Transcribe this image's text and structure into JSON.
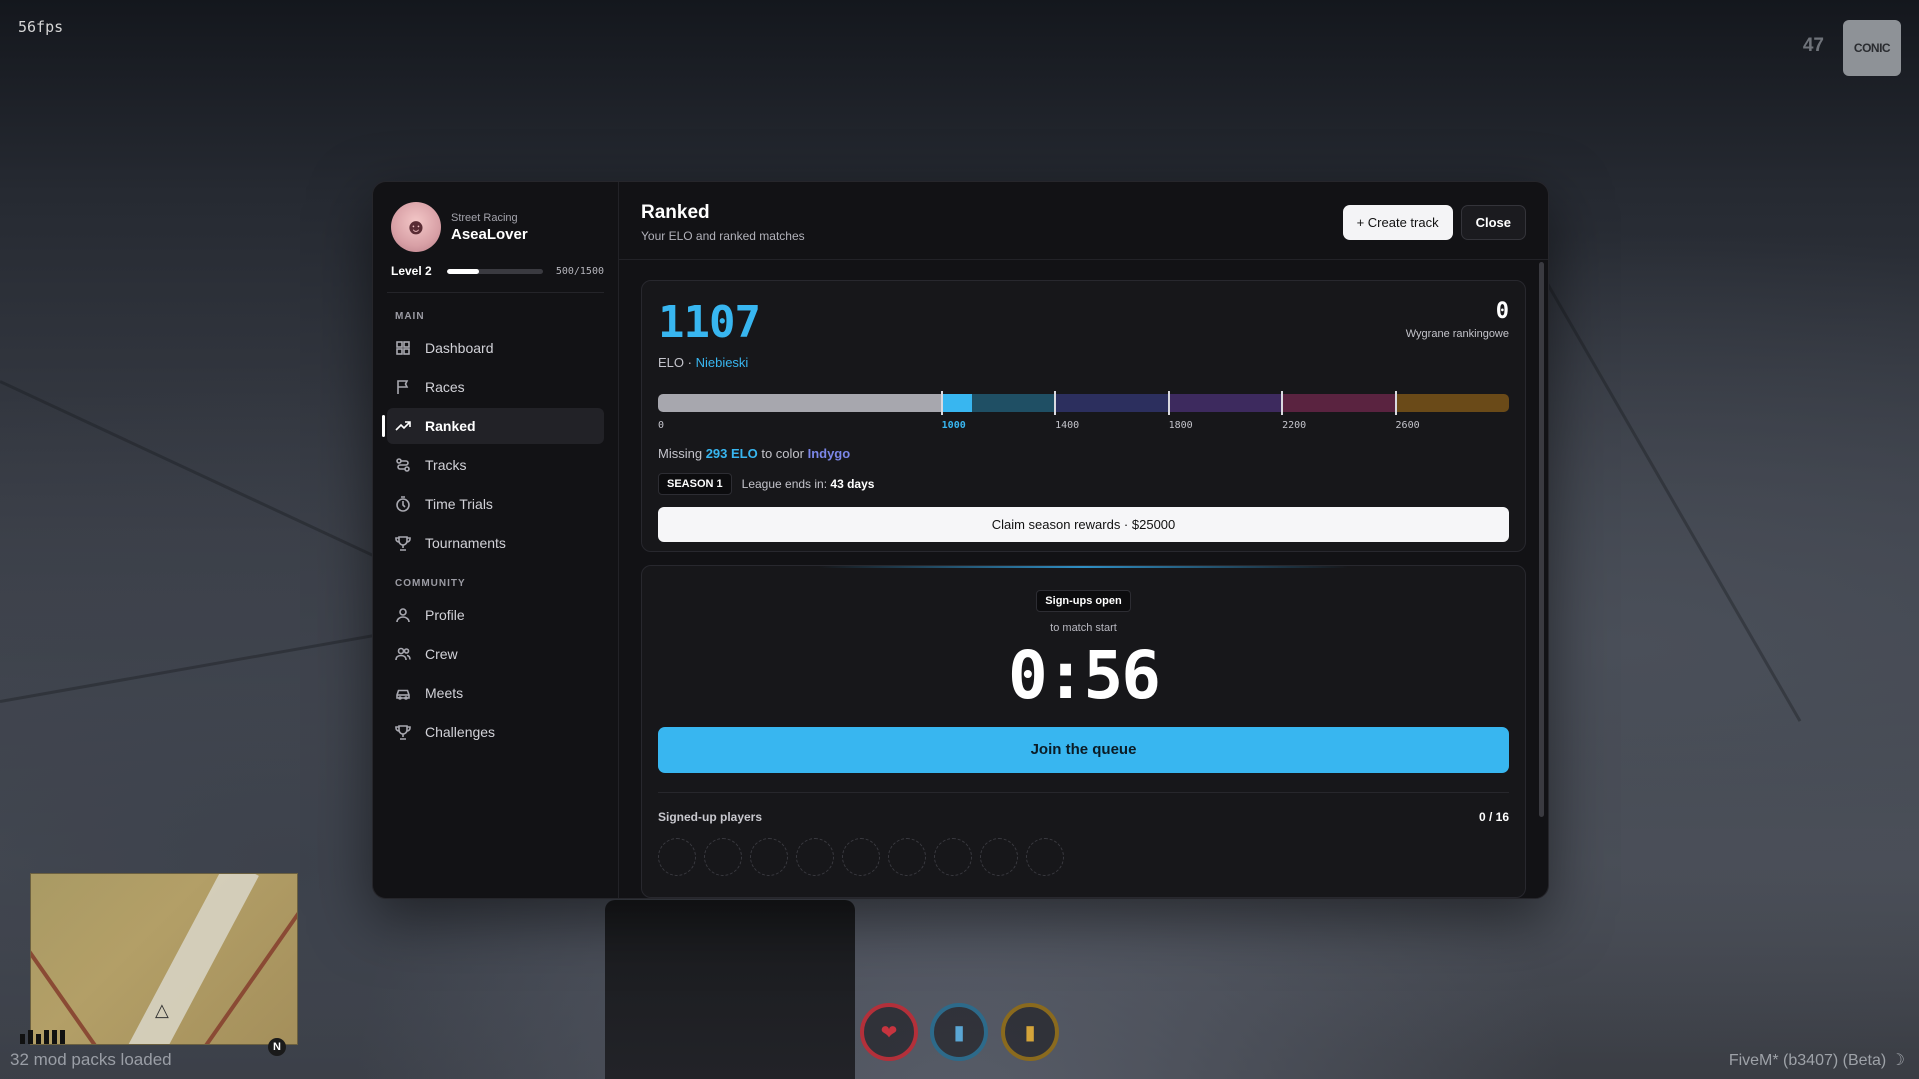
{
  "hud": {
    "fps": "56fps",
    "top_right_number": "47",
    "top_right_logo": "CONIC",
    "mod_packs": "32 mod packs loaded",
    "compass": "N",
    "fivem_version": "FiveM* (b3407) (Beta) ☽"
  },
  "user": {
    "subtitle": "Street Racing",
    "name": "AseaLover",
    "level_label": "Level 2",
    "xp_text": "500/1500",
    "xp_current": 500,
    "xp_max": 1500
  },
  "sidebar": {
    "main_label": "MAIN",
    "community_label": "COMMUNITY",
    "main_items": [
      {
        "label": "Dashboard",
        "icon": "dashboard-icon"
      },
      {
        "label": "Races",
        "icon": "flag-icon"
      },
      {
        "label": "Ranked",
        "icon": "trending-up-icon",
        "active": true
      },
      {
        "label": "Tracks",
        "icon": "route-icon"
      },
      {
        "label": "Time Trials",
        "icon": "timer-icon"
      },
      {
        "label": "Tournaments",
        "icon": "trophy-icon"
      }
    ],
    "community_items": [
      {
        "label": "Profile",
        "icon": "user-icon"
      },
      {
        "label": "Crew",
        "icon": "users-icon"
      },
      {
        "label": "Meets",
        "icon": "car-icon"
      },
      {
        "label": "Challenges",
        "icon": "trophy-icon"
      }
    ]
  },
  "header": {
    "title": "Ranked",
    "subtitle": "Your ELO and ranked matches",
    "create_track": "+ Create track",
    "close": "Close"
  },
  "elo": {
    "value": "1107",
    "label_prefix": "ELO · ",
    "tier": "Niebieski",
    "wins_value": "0",
    "wins_label": "Wygrane rankingowe",
    "scale_max": 3000,
    "current": 1107,
    "ticks": [
      {
        "value": 0,
        "label": "0"
      },
      {
        "value": 1000,
        "label": "1000",
        "current": true
      },
      {
        "value": 1400,
        "label": "1400"
      },
      {
        "value": 1800,
        "label": "1800"
      },
      {
        "value": 2200,
        "label": "2200"
      },
      {
        "value": 2600,
        "label": "2600"
      }
    ],
    "segments": [
      {
        "from": 0,
        "to": 1000,
        "color": "#a7a7ae"
      },
      {
        "from": 1000,
        "to": 1400,
        "color": "#1f4f64",
        "highlight": "#38b6f0"
      },
      {
        "from": 1400,
        "to": 1800,
        "color": "#2c2f5e"
      },
      {
        "from": 1800,
        "to": 2200,
        "color": "#3d2a5e"
      },
      {
        "from": 2200,
        "to": 2600,
        "color": "#5a2340"
      },
      {
        "from": 2600,
        "to": 3000,
        "color": "#6a4a18"
      }
    ],
    "missing_prefix": "Missing ",
    "missing_amount": "293 ELO",
    "missing_mid": " to color ",
    "missing_target": "Indygo",
    "season_badge": "SEASON 1",
    "league_prefix": "League ends in: ",
    "league_days": "43 days",
    "claim_label": "Claim season rewards · $25000"
  },
  "queue": {
    "badge": "Sign-ups open",
    "to_match": "to match start",
    "countdown": "0:56",
    "join_label": "Join the queue",
    "players_label": "Signed-up players",
    "players_count": "0 / 16",
    "visible_slots": 9
  },
  "colors": {
    "accent": "#38b6f0",
    "indigo": "#7b86e8"
  }
}
